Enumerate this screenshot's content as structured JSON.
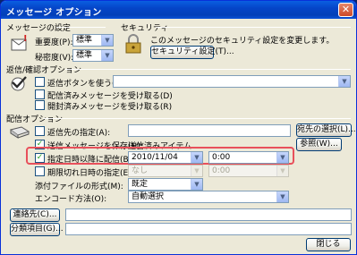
{
  "window": {
    "title": "メッセージ オプション",
    "close_glyph": "✕"
  },
  "message_settings": {
    "header": "メッセージの設定",
    "importance_label": "重要度(P):",
    "importance_value": "標準",
    "sensitivity_label": "秘密度(V):",
    "sensitivity_value": "標準"
  },
  "security": {
    "header": "セキュリティ",
    "description": "このメッセージのセキュリティ設定を変更します。",
    "button_label": "セキュリティ設定(T)..."
  },
  "voting": {
    "header": "返信/確認オプション",
    "use_voting_buttons": "返信ボタンを使う(U):",
    "read_receipt_delivered": "配信済みメッセージを受け取る(D)",
    "read_receipt_read": "開封済みメッセージを受け取る(R)"
  },
  "delivery": {
    "header": "配信オプション",
    "reply_to_label": "返信先の指定(A):",
    "select_names_button": "宛先の選択(L)...",
    "save_sent_label": "送信メッセージを保存(N):",
    "save_sent_folder": "送信済みアイテム",
    "browse_button": "参照(W)...",
    "delay_delivery_label": "指定日時以降に配信(B):",
    "delay_date": "2010/11/04",
    "delay_time": "0:00",
    "expire_label": "期限切れ日時の指定(E):",
    "expire_date": "なし",
    "expire_time": "0:00",
    "attachment_format_label": "添付ファイルの形式(M):",
    "attachment_format_value": "既定",
    "encoding_label": "エンコード方法(O):",
    "encoding_value": "自動選択"
  },
  "footer": {
    "contacts_button": "連絡先(C)...",
    "categories_button": "分類項目(G)...",
    "close_button": "閉じる"
  },
  "state": {
    "save_sent_checked": true,
    "delay_delivery_checked": true
  },
  "colors": {
    "title_bar": "#0a52d8",
    "highlight": "#e8505b",
    "window_bg": "#ece9d8"
  }
}
